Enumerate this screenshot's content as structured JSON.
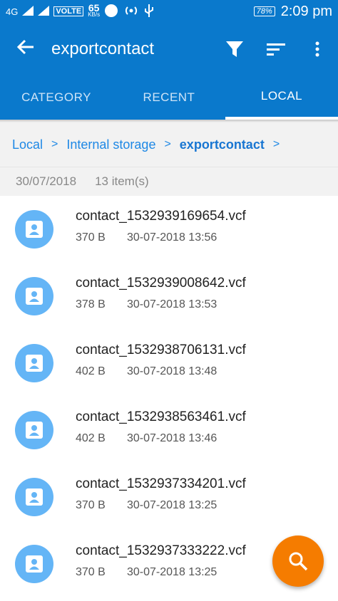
{
  "status_bar": {
    "network": "4G",
    "volte": "VOLTE",
    "speed_value": "65",
    "speed_unit": "KB/s",
    "battery": "78%",
    "time": "2:09 pm"
  },
  "app_bar": {
    "title": "exportcontact"
  },
  "tabs": [
    {
      "label": "CATEGORY"
    },
    {
      "label": "RECENT"
    },
    {
      "label": "LOCAL"
    }
  ],
  "breadcrumb": {
    "items": [
      "Local",
      "Internal storage",
      "exportcontact"
    ],
    "separator": ">"
  },
  "folder_info": {
    "date": "30/07/2018",
    "count": "13 item(s)"
  },
  "files": [
    {
      "name": "contact_1532939169654.vcf",
      "size": "370 B",
      "date": "30-07-2018 13:56"
    },
    {
      "name": "contact_1532939008642.vcf",
      "size": "378 B",
      "date": "30-07-2018 13:53"
    },
    {
      "name": "contact_1532938706131.vcf",
      "size": "402 B",
      "date": "30-07-2018 13:48"
    },
    {
      "name": "contact_1532938563461.vcf",
      "size": "402 B",
      "date": "30-07-2018 13:46"
    },
    {
      "name": "contact_1532937334201.vcf",
      "size": "370 B",
      "date": "30-07-2018 13:25"
    },
    {
      "name": "contact_1532937333222.vcf",
      "size": "370 B",
      "date": "30-07-2018 13:25"
    }
  ],
  "colors": {
    "primary": "#0a79cc",
    "avatar": "#64b5f6",
    "fab": "#f57c00"
  }
}
